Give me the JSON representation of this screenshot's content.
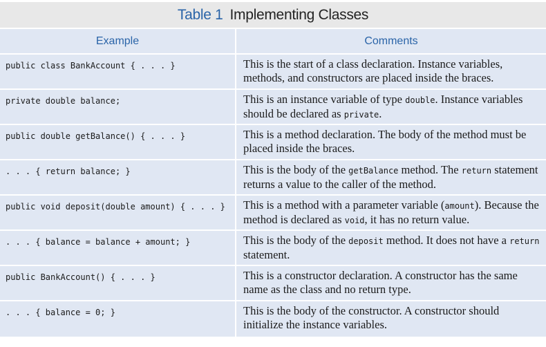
{
  "title": {
    "number": "Table 1",
    "name": "Implementing Classes"
  },
  "colors": {
    "accent": "#2a64a8",
    "title_bg": "#e8e8e8",
    "cell_bg": "#e0e7f3"
  },
  "headers": {
    "example": "Example",
    "comments": "Comments"
  },
  "rows": [
    {
      "example": "public class BankAccount { . . . }",
      "comment": [
        {
          "t": "This is the start of a class declaration. Instance variables, methods, and constructors are placed inside the braces."
        }
      ]
    },
    {
      "example": "private double balance;",
      "comment": [
        {
          "t": "This is an instance variable of type "
        },
        {
          "c": "double"
        },
        {
          "t": ". Instance variables should be declared as "
        },
        {
          "c": "private"
        },
        {
          "t": "."
        }
      ]
    },
    {
      "example": "public double getBalance() { . . . }",
      "comment": [
        {
          "t": "This is a method declaration. The body of the method must be placed inside the braces."
        }
      ]
    },
    {
      "example": ". . . { return balance; }",
      "comment": [
        {
          "t": "This is the body of the "
        },
        {
          "c": "getBalance"
        },
        {
          "t": " method. The "
        },
        {
          "c": "return"
        },
        {
          "t": " statement returns a value to the caller of the method."
        }
      ]
    },
    {
      "example": "public void deposit(double amount) { . . . }",
      "comment": [
        {
          "t": "This is a method with a parameter variable ("
        },
        {
          "c": "amount"
        },
        {
          "t": "). Because the method is declared as "
        },
        {
          "c": "void"
        },
        {
          "t": ", it has no return value."
        }
      ]
    },
    {
      "example": ". . . { balance = balance + amount; }",
      "comment": [
        {
          "t": "This is the body of the "
        },
        {
          "c": "deposit"
        },
        {
          "t": " method. It does not have a "
        },
        {
          "c": "return"
        },
        {
          "t": " statement."
        }
      ]
    },
    {
      "example": "public BankAccount() { . . . }",
      "comment": [
        {
          "t": "This is a constructor declaration. A constructor has the same name as the class and no return type."
        }
      ]
    },
    {
      "example": ". . . { balance = 0; }",
      "comment": [
        {
          "t": "This is the body of the constructor. A constructor should initialize the instance variables."
        }
      ]
    }
  ]
}
